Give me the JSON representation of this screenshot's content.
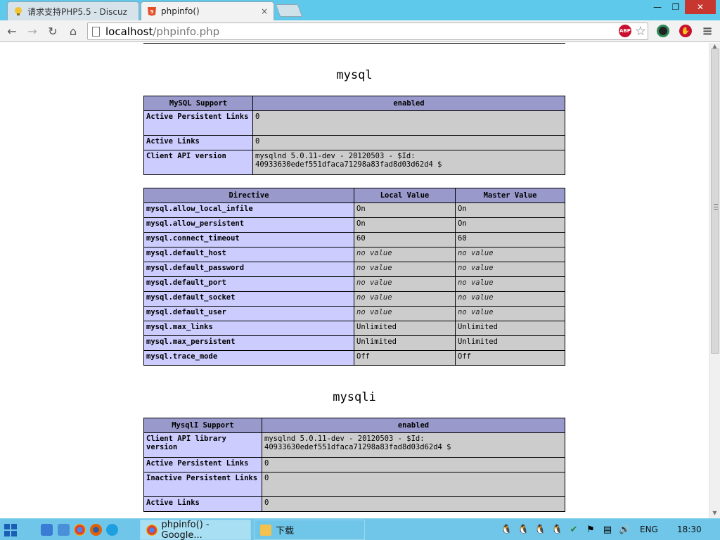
{
  "browser": {
    "tabs": [
      {
        "label": "请求支持PHP5.5 - Discuz",
        "icon": "lightbulb-icon"
      },
      {
        "label": "phpinfo()",
        "icon": "html5-icon",
        "close": "×"
      }
    ],
    "window_controls": {
      "minimize": "—",
      "maximize": "❐",
      "close": "✕"
    },
    "nav": {
      "back": "←",
      "forward": "→",
      "reload": "↻",
      "home": "⌂"
    },
    "address": {
      "host": "localhost",
      "path": "/phpinfo.php"
    },
    "extensions": [
      {
        "name": "adblock-plus-icon",
        "label": "ABP",
        "color": "#c8102e"
      },
      {
        "name": "bookmark-star-icon",
        "label": "☆",
        "color": "#777777"
      },
      {
        "name": "camera-extension-icon",
        "label": "",
        "color": "#222222"
      },
      {
        "name": "stop-extension-icon",
        "label": "✋",
        "color": "#c8102e"
      },
      {
        "name": "menu-icon",
        "label": "≡",
        "color": "#555555"
      }
    ]
  },
  "page": {
    "sections": [
      {
        "title": "mysql",
        "support_table": {
          "headers": [
            "MySQL Support",
            "enabled"
          ],
          "rows": [
            [
              "Active Persistent Links",
              "0"
            ],
            [
              "Active Links",
              "0"
            ],
            [
              "Client API version",
              "mysqlnd 5.0.11-dev - 20120503 - $Id: 40933630edef551dfaca71298a83fad8d03d62d4 $"
            ]
          ]
        },
        "directive_table": {
          "headers": [
            "Directive",
            "Local Value",
            "Master Value"
          ],
          "rows": [
            [
              "mysql.allow_local_infile",
              "On",
              "On"
            ],
            [
              "mysql.allow_persistent",
              "On",
              "On"
            ],
            [
              "mysql.connect_timeout",
              "60",
              "60"
            ],
            [
              "mysql.default_host",
              "no value",
              "no value"
            ],
            [
              "mysql.default_password",
              "no value",
              "no value"
            ],
            [
              "mysql.default_port",
              "no value",
              "no value"
            ],
            [
              "mysql.default_socket",
              "no value",
              "no value"
            ],
            [
              "mysql.default_user",
              "no value",
              "no value"
            ],
            [
              "mysql.max_links",
              "Unlimited",
              "Unlimited"
            ],
            [
              "mysql.max_persistent",
              "Unlimited",
              "Unlimited"
            ],
            [
              "mysql.trace_mode",
              "Off",
              "Off"
            ]
          ]
        }
      },
      {
        "title": "mysqli",
        "support_table": {
          "headers": [
            "MysqlI Support",
            "enabled"
          ],
          "rows": [
            [
              "Client API library version",
              "mysqlnd 5.0.11-dev - 20120503 - $Id: 40933630edef551dfaca71298a83fad8d03d62d4 $"
            ],
            [
              "Active Persistent Links",
              "0"
            ],
            [
              "Inactive Persistent Links",
              "0"
            ],
            [
              "Active Links",
              "0"
            ]
          ]
        }
      }
    ]
  },
  "taskbar": {
    "tasks": [
      {
        "label": "phpinfo() - Google...",
        "icon": "chrome-icon",
        "active": true
      },
      {
        "label": "下载",
        "icon": "folder-icon",
        "active": false
      }
    ],
    "language": "ENG",
    "clock": "18:30"
  },
  "colors": {
    "php_header": "#9999cc",
    "php_key": "#ccccff",
    "php_value": "#cccccc",
    "titlebar": "#5fc9eb",
    "taskbar": "#6fc6e8"
  }
}
